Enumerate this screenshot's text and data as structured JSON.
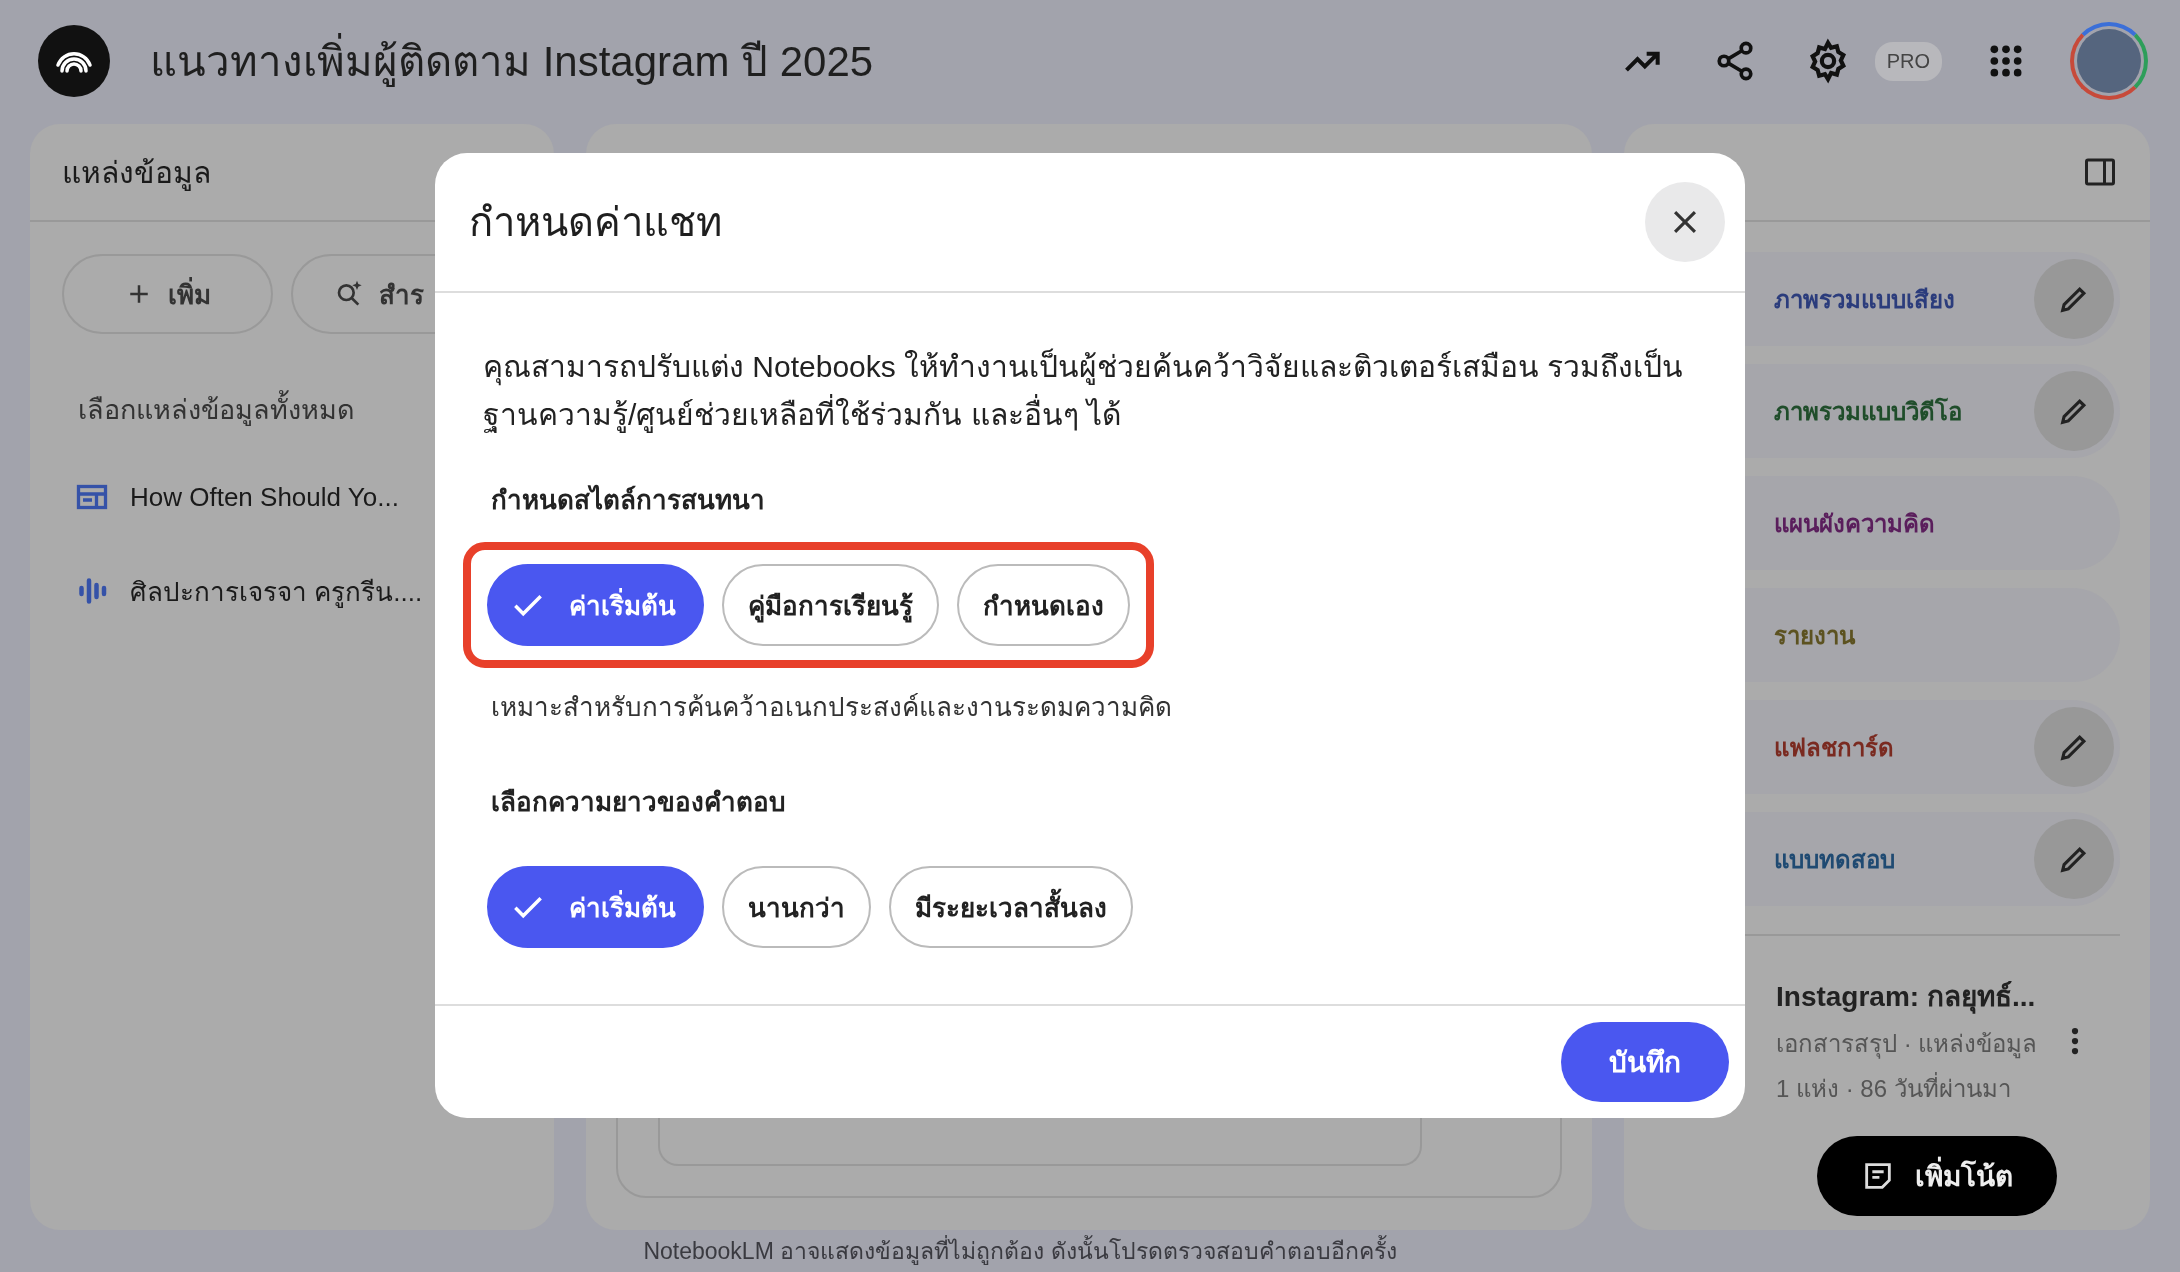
{
  "header": {
    "title": "แนวทางเพิ่มผู้ติดตาม Instagram ปี 2025",
    "pro_badge": "PRO"
  },
  "sources": {
    "title": "แหล่งข้อมูล",
    "buttons": [
      {
        "label": "เพิ่ม",
        "kind": "add"
      },
      {
        "label": "สำร",
        "kind": "discover"
      }
    ],
    "select_all": "เลือกแหล่งข้อมูลทั้งหมด",
    "items": [
      {
        "title": "How Often Should Yo...",
        "kind": "web"
      },
      {
        "title": "ศิลปะการเจรจา ครูกรีน....",
        "kind": "audio"
      }
    ]
  },
  "studio": {
    "items": [
      {
        "label": "ภาพรวมแบบเสียง",
        "color": "#2b3c7c",
        "editable": true
      },
      {
        "label": "ภาพรวมแบบวิดีโอ",
        "color": "#1f4d2a",
        "editable": true
      },
      {
        "label": "แผนผังความคิด",
        "color": "#5a1e5c",
        "editable": false
      },
      {
        "label": "รายงาน",
        "color": "#5c5220",
        "editable": false
      },
      {
        "label": "แฟลชการ์ด",
        "color": "#7a2a20",
        "editable": true
      },
      {
        "label": "แบบทดสอบ",
        "color": "#1f4a72",
        "editable": true
      }
    ],
    "note": {
      "title": "Instagram: กลยุทธ์...",
      "meta": "เอกสารสรุป · แหล่งข้อมูล",
      "meta_2": "1 แห่ง · 86 วันที่ผ่านมา"
    },
    "add_note": "เพิ่มโน้ต"
  },
  "footer": "NotebookLM อาจแสดงข้อมูลที่ไม่ถูกต้อง ดังนั้นโปรดตรวจสอบคำตอบอีกครั้ง",
  "dialog": {
    "title": "กำหนดค่าแชท",
    "description": "คุณสามารถปรับแต่ง Notebooks ให้ทำงานเป็นผู้ช่วยค้นคว้าวิจัยและติวเตอร์เสมือน รวมถึงเป็นฐานความรู้/ศูนย์ช่วยเหลือที่ใช้ร่วมกัน และอื่นๆ ได้",
    "groups": [
      {
        "label": "กำหนดสไตล์การสนทนา",
        "highlighted": true,
        "options": [
          {
            "label": "ค่าเริ่มต้น",
            "selected": true
          },
          {
            "label": "คู่มือการเรียนรู้",
            "selected": false
          },
          {
            "label": "กำหนดเอง",
            "selected": false
          }
        ],
        "hint": "เหมาะสำหรับการค้นคว้าอเนกประสงค์และงานระดมความคิด"
      },
      {
        "label": "เลือกความยาวของคำตอบ",
        "highlighted": false,
        "options": [
          {
            "label": "ค่าเริ่มต้น",
            "selected": true
          },
          {
            "label": "นานกว่า",
            "selected": false
          },
          {
            "label": "มีระยะเวลาสั้นลง",
            "selected": false
          }
        ]
      }
    ],
    "save": "บันทึก"
  }
}
